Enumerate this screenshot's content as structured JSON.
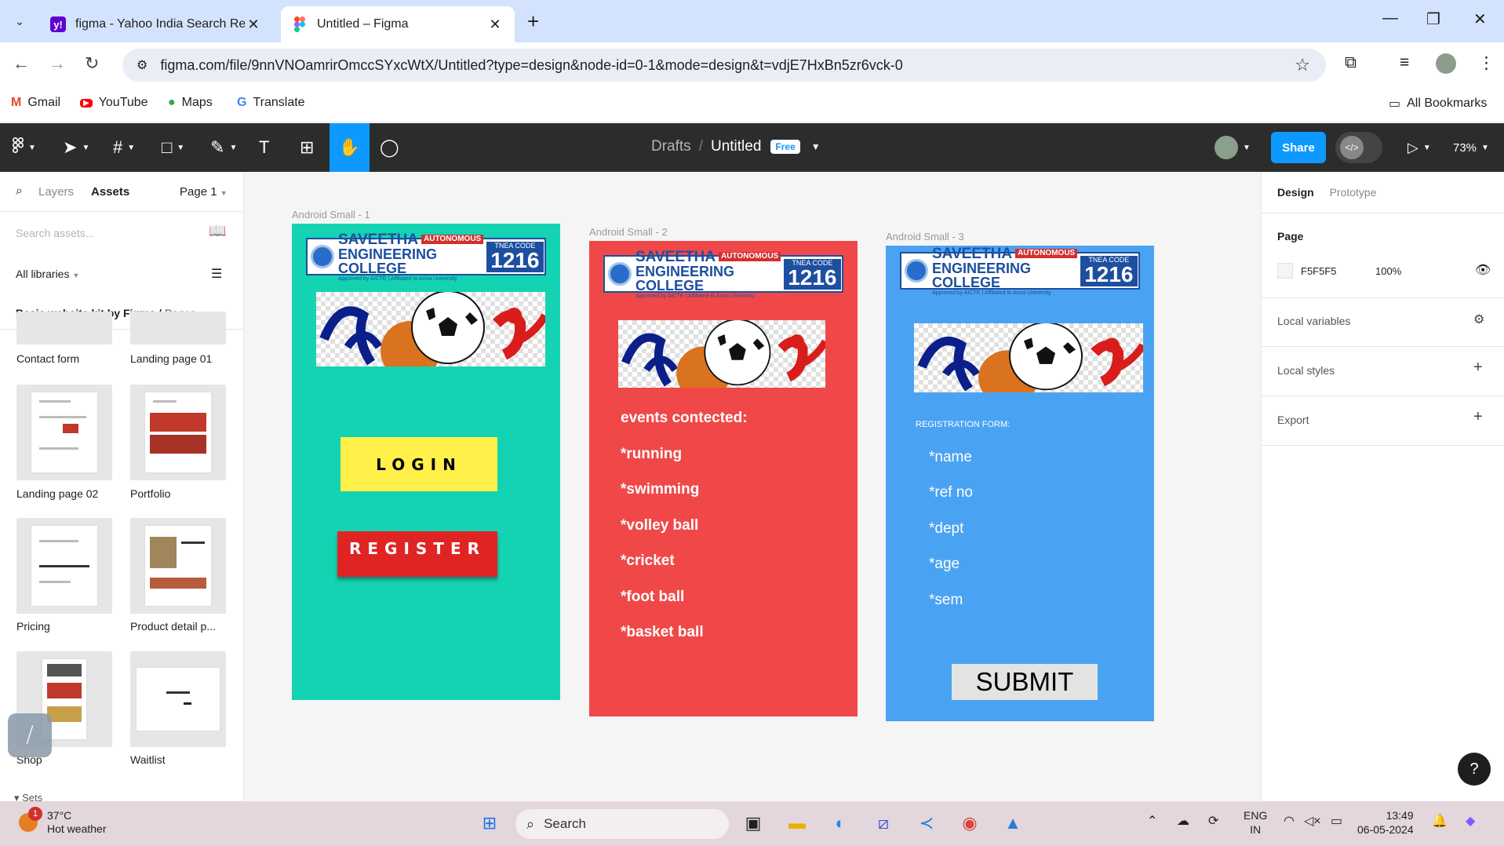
{
  "browser": {
    "tabs": [
      {
        "title": "figma - Yahoo India Search Res",
        "favicon": "yahoo-icon",
        "active": false
      },
      {
        "title": "Untitled – Figma",
        "favicon": "figma-icon",
        "active": true
      }
    ],
    "url": "figma.com/file/9nnVNOamrirOmccSYxcWtX/Untitled?type=design&node-id=0-1&mode=design&t=vdjE7HxBn5zr6vck-0",
    "bookmarks": [
      {
        "label": "Gmail",
        "icon": "gmail-icon"
      },
      {
        "label": "YouTube",
        "icon": "youtube-icon"
      },
      {
        "label": "Maps",
        "icon": "maps-icon"
      },
      {
        "label": "Translate",
        "icon": "translate-icon"
      }
    ],
    "all_bookmarks": "All Bookmarks"
  },
  "figma": {
    "breadcrumb": {
      "folder": "Drafts",
      "sep": "/",
      "file": "Untitled",
      "plan": "Free"
    },
    "share": "Share",
    "zoom": "73%",
    "left_panel": {
      "tab_layers": "Layers",
      "tab_assets": "Assets",
      "page": "Page 1",
      "search_placeholder": "Search assets...",
      "libraries": "All libraries",
      "kit_name": "Basic website kit by Figma /",
      "kit_pages": "Pages",
      "components": [
        "Contact form",
        "Landing page 01",
        "Landing page 02",
        "Portfolio",
        "Pricing",
        "Product detail p...",
        "Shop",
        "Waitlist"
      ],
      "sets": "Sets"
    },
    "right_panel": {
      "tab_design": "Design",
      "tab_prototype": "Prototype",
      "page_heading": "Page",
      "page_color": "F5F5F5",
      "page_opacity": "100%",
      "local_variables": "Local variables",
      "local_styles": "Local styles",
      "export": "Export"
    }
  },
  "canvas": {
    "college": {
      "name1": "SAVEETHA",
      "autonomous": "AUTONOMOUS",
      "name2": "ENGINEERING COLLEGE",
      "approved": "Approved by AICTE | Affiliated to Anna University",
      "tnea_label": "TNEA CODE",
      "tnea_code": "1216"
    },
    "frame1": {
      "label": "Android Small - 1",
      "bg": "#14d3b2",
      "login": "LOGIN",
      "register": "REGISTER"
    },
    "frame2": {
      "label": "Android Small - 2",
      "bg": "#f04848",
      "title": "events contected:",
      "events": [
        "*running",
        "*swimming",
        "*volley ball",
        "*cricket",
        "*foot ball",
        "*basket ball"
      ]
    },
    "frame3": {
      "label": "Android Small - 3",
      "bg": "#4aa3f2",
      "title": "REGISTRATION FORM:",
      "fields": [
        "*name",
        "*ref no",
        "*dept",
        "*age",
        "*sem"
      ],
      "submit": "SUBMIT"
    }
  },
  "taskbar": {
    "temp": "37°C",
    "weather": "Hot weather",
    "weather_badge": "1",
    "search": "Search",
    "lang1": "ENG",
    "lang2": "IN",
    "time": "13:49",
    "date": "06-05-2024"
  }
}
